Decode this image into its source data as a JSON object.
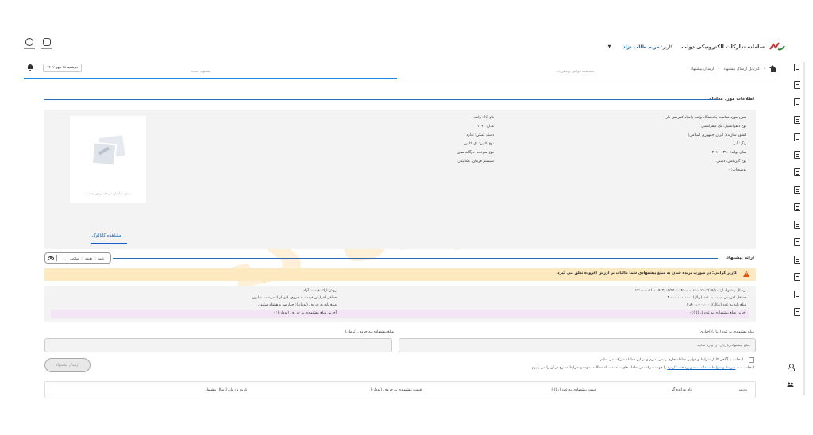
{
  "header": {
    "system_title": "سامانه تدارکات الکترونیکی دولت",
    "user_label": "کاربر:",
    "user_name": "مریم طالب نژاد"
  },
  "topbar": {
    "date": "دوشنبه ۱۸ مهر ۱۴۰۲"
  },
  "breadcrumb": {
    "items": [
      "کارتابل ارسال پیشنهاد",
      "ارسال پیشنهاد"
    ]
  },
  "tabs": {
    "left_label": "پیشنهاد قیمت",
    "right_label": "مشاهده قوانین و مقررات"
  },
  "deal": {
    "title": "اطلاعات مورد معامله",
    "right_fields": [
      "شرح مورد معامله: یکدستگاه وانت زامیاد کمرسی دار",
      "نوع دیفرانسیل: تک دیفرانسیل",
      "کشور سازنده: ایران(جمهوری اسلامی)",
      "رنگ: آبی",
      "سال تولید: ۱۳۹۰-۲۰۱۱",
      "نوع گیربکس: دستی",
      "توضیحات: -"
    ],
    "left_fields": [
      "نام کالا: وانت",
      "مدل: ۱۳۹۰",
      "دسته کمکی: ندارد",
      "نوع کابین: تک کابین",
      "نوع سوخت: دوگانه سوز",
      "سیستم فرمان: مکانیکی"
    ],
    "no_preview": "پیش نمایش در دسترس نیست",
    "catalog_link": "مشاهده کاتالوگ"
  },
  "toolbar": {
    "hour": "ساعت",
    "minute": "دقیقه",
    "second": "ثانیه"
  },
  "offer": {
    "title": "ارائه پیشنهاد",
    "warning": "کاربر گرامی: در صورت برنده شدن به مبلغ پیشنهادی شما مالیات بر ارزش افزوده تعلق می گیرد.",
    "right_info": [
      "ارسال پیشنهاد از: ۱۴۰۲/۰۵/۱۰ ساعت ۱۴:۰۰ تا ۱۴۰۲/۰۵/۱۵ ساعت ۱۲:۰۰",
      "حداقل افزایش قیمت به عدد (ریال): ۳،۰۰۰،۰۰۰،۰۰۰",
      "مبلغ پایه به عدد (ریال): ۴،۸۰۰،۰۰۰،۰۰۰",
      "آخرین مبلغ پیشنهادی به عدد (ریال): -"
    ],
    "left_info": [
      "روش ارائه قیمت: آزاد",
      "حداقل افزایش قیمت به حروف (تومان): دویست میلیون",
      "مبلغ پایه به حروف (تومان): چهارصد و هشتاد میلیون",
      "آخرین مبلغ پیشنهادی به حروف (تومان): -"
    ],
    "amount_label": "مبلغ پیشنهادی به عدد (ریال)(اجباری)",
    "amount_placeholder": "مبلغ پیشنهادی(ریال) را وارد نمایید",
    "words_label": "مبلغ پیشنهادی به حروف (تومان)",
    "agree1": "اینجانب با آگاهی کامل شرایط و قوانین معامله جاری را می پذیرم و در این معامله شرکت می نمایم.",
    "agree2_a": "اینجانب سند",
    "agree2_link": "شرایط و ضوابط سامانه ستاد و پرداخت کارمزد",
    "agree2_b": "را جهت شرکت در معامله های سامانه ستاد مطالعه نموده و شرایط مندرج در آن را می پذیرم.",
    "send_button": "ارسال پیشنهاد"
  },
  "table": {
    "headers": [
      "ردیف",
      "نام مزایده گر",
      "قیمت پیشنهادی به عدد (ریال)",
      "قیمت پیشنهادی به حروف (تومان)",
      "تاریخ و زمان ارسال پیشنهاد"
    ]
  },
  "watermark": {
    "text": "مزایده گر"
  },
  "colors": {
    "accent": "#2a6cb3",
    "link": "#1565c0",
    "warning_bg": "#fde9bf",
    "warning_icon": "#e65100",
    "watermark": "#f6aa1e"
  }
}
